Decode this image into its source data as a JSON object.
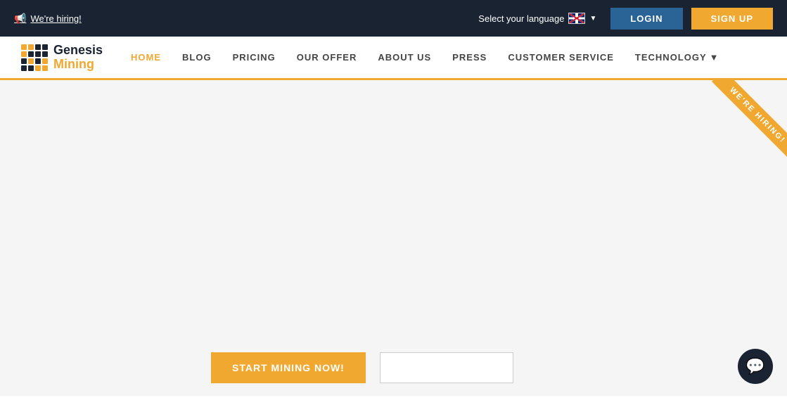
{
  "topbar": {
    "hiring_text": "We're hiring!",
    "language_label": "Select your language",
    "login_label": "LOGIN",
    "signup_label": "SIGN UP"
  },
  "nav": {
    "logo_genesis": "Genesis",
    "logo_mining": "Mining",
    "items": [
      {
        "label": "HOME",
        "active": true
      },
      {
        "label": "BLOG",
        "active": false
      },
      {
        "label": "PRICING",
        "active": false
      },
      {
        "label": "OUR OFFER",
        "active": false
      },
      {
        "label": "ABOUT US",
        "active": false
      },
      {
        "label": "PRESS",
        "active": false
      },
      {
        "label": "CUSTOMER SERVICE",
        "active": false
      },
      {
        "label": "TECHNOLOGY",
        "active": false,
        "dropdown": true
      }
    ]
  },
  "hero": {
    "ribbon_text": "WE'RE HIRING!"
  },
  "cta": {
    "start_mining_label": "START MINING NOW!",
    "search_placeholder": ""
  },
  "chat": {
    "icon": "💬"
  }
}
